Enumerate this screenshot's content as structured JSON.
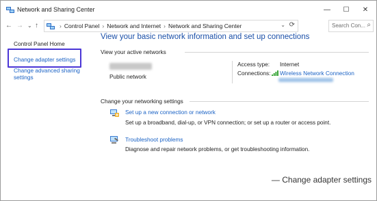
{
  "window": {
    "title": "Network and Sharing Center",
    "controls": {
      "minimize": "—",
      "maximize": "☐",
      "close": "✕"
    }
  },
  "nav": {
    "back": "←",
    "forward": "→",
    "recent": "⌄",
    "up": "↑",
    "breadcrumbs": [
      "Control Panel",
      "Network and Internet",
      "Network and Sharing Center"
    ],
    "separator": "›",
    "leading_chevron": "›",
    "address_dropdown": "⌄",
    "refresh": "⟳",
    "search_placeholder": "Search Con...",
    "search_icon": "⌕"
  },
  "left_pane": {
    "home": "Control Panel Home",
    "change_adapter": "Change adapter settings",
    "change_advanced": "Change advanced sharing settings"
  },
  "main": {
    "heading": "View your basic network information and set up connections",
    "active_networks_label": "View your active networks",
    "network_type": "Public network",
    "access_type_label": "Access type:",
    "access_type_value": "Internet",
    "connections_label": "Connections:",
    "connection_name": "Wireless Network Connection",
    "change_settings_label": "Change your networking settings",
    "tasks": [
      {
        "icon": "new-connection-icon",
        "title": "Set up a new connection or network",
        "desc": "Set up a broadband, dial-up, or VPN connection; or set up a router or access point."
      },
      {
        "icon": "troubleshoot-icon",
        "title": "Troubleshoot problems",
        "desc": "Diagnose and repair network problems, or get troubleshooting information."
      }
    ]
  },
  "caption": "— Change adapter settings",
  "colors": {
    "link": "#1a62c5",
    "heading": "#1a4fa8",
    "highlight_box": "#4a35d6"
  }
}
